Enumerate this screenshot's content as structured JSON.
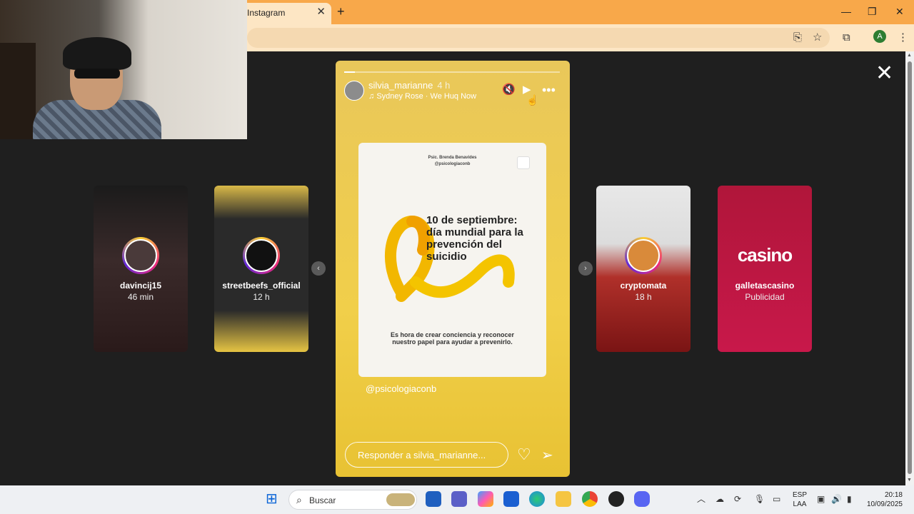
{
  "browser": {
    "tab_title": "Instagram",
    "tab_close": "✕",
    "new_tab": "+",
    "window_controls": {
      "minimize": "—",
      "restore": "❐",
      "close": "✕"
    },
    "profile_initial": "A"
  },
  "viewer": {
    "close": "✕",
    "prev_arrow": "‹",
    "next_arrow": "›"
  },
  "side_stories": [
    {
      "username": "davincij15",
      "time": "46 min"
    },
    {
      "username": "streetbeefs_official",
      "time": "12 h"
    },
    {
      "username": "cryptomata",
      "time": "18 h"
    },
    {
      "username": "galletascasino",
      "time": "Publicidad"
    }
  ],
  "story": {
    "username": "silvia_marianne",
    "time": "4 h",
    "music": "Sydney Rose · We Huq Now",
    "progress": 0.05,
    "post": {
      "author": "Psic. Brenda Benavides",
      "handle": "@psicologiaconb",
      "title": "10 de septiembre: día mundial para la prevención del suicidio",
      "body": "Es hora de crear conciencia y reconocer nuestro papel para ayudar a prevenirlo."
    },
    "mention": "@psicologiaconb",
    "reply_placeholder": "Responder a silvia_marianne..."
  },
  "taskbar": {
    "search_placeholder": "Buscar",
    "lang_line1": "ESP",
    "lang_line2": "LAA",
    "time": "20:18",
    "date": "10/09/2025"
  },
  "colors": {
    "chrome_tabbar": "#f8a84a",
    "chrome_toolbar": "#fde6c4",
    "story_bg": "#f1cf4a",
    "viewer_bg": "#1f1f1f"
  }
}
